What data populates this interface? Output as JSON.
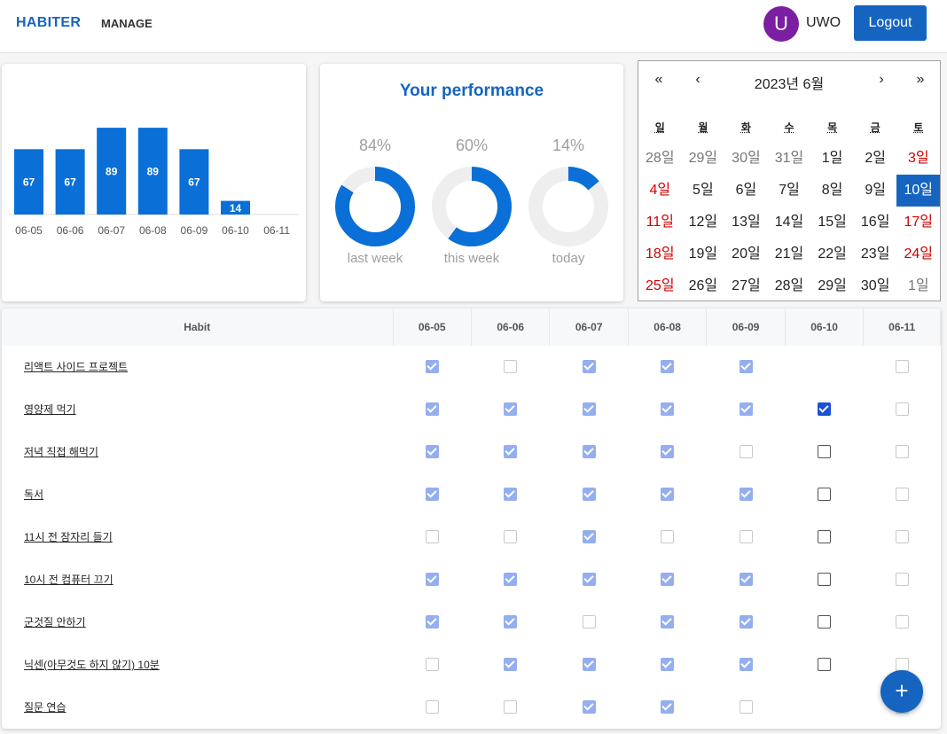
{
  "header": {
    "brand": "HABITER",
    "nav_manage": "MANAGE",
    "avatar_letter": "U",
    "username": "UWO",
    "logout_label": "Logout"
  },
  "chart_data": {
    "type": "bar",
    "categories": [
      "06-05",
      "06-06",
      "06-07",
      "06-08",
      "06-09",
      "06-10",
      "06-11"
    ],
    "values": [
      67,
      67,
      89,
      89,
      67,
      14,
      0
    ],
    "ylim": [
      0,
      100
    ],
    "color": "#0a6fd6"
  },
  "performance": {
    "title": "Your performance",
    "items": [
      {
        "percent_label": "84%",
        "value": 84,
        "label": "last week"
      },
      {
        "percent_label": "60%",
        "value": 60,
        "label": "this week"
      },
      {
        "percent_label": "14%",
        "value": 14,
        "label": "today"
      }
    ],
    "ring_color": "#0a6fd6",
    "track_color": "#eeeeee"
  },
  "calendar": {
    "title": "2023년 6월",
    "nav": {
      "prev_year": "«",
      "prev_month": "‹",
      "next_month": "›",
      "next_year": "»"
    },
    "weekdays": [
      "일",
      "월",
      "화",
      "수",
      "목",
      "금",
      "토"
    ],
    "weeks": [
      [
        {
          "d": "28일",
          "t": "other"
        },
        {
          "d": "29일",
          "t": "other"
        },
        {
          "d": "30일",
          "t": "other"
        },
        {
          "d": "31일",
          "t": "other"
        },
        {
          "d": "1일",
          "t": ""
        },
        {
          "d": "2일",
          "t": ""
        },
        {
          "d": "3일",
          "t": "sun"
        }
      ],
      [
        {
          "d": "4일",
          "t": "sun"
        },
        {
          "d": "5일",
          "t": ""
        },
        {
          "d": "6일",
          "t": ""
        },
        {
          "d": "7일",
          "t": ""
        },
        {
          "d": "8일",
          "t": ""
        },
        {
          "d": "9일",
          "t": ""
        },
        {
          "d": "10일",
          "t": "sel"
        }
      ],
      [
        {
          "d": "11일",
          "t": "sun"
        },
        {
          "d": "12일",
          "t": ""
        },
        {
          "d": "13일",
          "t": ""
        },
        {
          "d": "14일",
          "t": ""
        },
        {
          "d": "15일",
          "t": ""
        },
        {
          "d": "16일",
          "t": ""
        },
        {
          "d": "17일",
          "t": "sun"
        }
      ],
      [
        {
          "d": "18일",
          "t": "sun"
        },
        {
          "d": "19일",
          "t": ""
        },
        {
          "d": "20일",
          "t": ""
        },
        {
          "d": "21일",
          "t": ""
        },
        {
          "d": "22일",
          "t": ""
        },
        {
          "d": "23일",
          "t": ""
        },
        {
          "d": "24일",
          "t": "sun"
        }
      ],
      [
        {
          "d": "25일",
          "t": "sun"
        },
        {
          "d": "26일",
          "t": ""
        },
        {
          "d": "27일",
          "t": ""
        },
        {
          "d": "28일",
          "t": ""
        },
        {
          "d": "29일",
          "t": ""
        },
        {
          "d": "30일",
          "t": ""
        },
        {
          "d": "1일",
          "t": "other"
        }
      ]
    ]
  },
  "habits": {
    "header": "Habit",
    "dates": [
      "06-05",
      "06-06",
      "06-07",
      "06-08",
      "06-09",
      "06-10",
      "06-11"
    ],
    "rows": [
      {
        "name": "리액트 사이드 프로젝트",
        "checks": [
          "c",
          "e",
          "c",
          "c",
          "c",
          "n",
          "e"
        ]
      },
      {
        "name": "영양제 먹기",
        "checks": [
          "c",
          "c",
          "c",
          "c",
          "c",
          "a",
          "e"
        ]
      },
      {
        "name": "저녁 직접 해먹기",
        "checks": [
          "c",
          "c",
          "c",
          "c",
          "e",
          "t",
          "e"
        ]
      },
      {
        "name": "독서",
        "checks": [
          "c",
          "c",
          "c",
          "c",
          "c",
          "t",
          "e"
        ]
      },
      {
        "name": "11시 전 잠자리 들기",
        "checks": [
          "e",
          "e",
          "c",
          "e",
          "e",
          "t",
          "e"
        ]
      },
      {
        "name": "10시 전 컴퓨터 끄기",
        "checks": [
          "c",
          "c",
          "c",
          "c",
          "c",
          "t",
          "e"
        ]
      },
      {
        "name": "군것질 안하기",
        "checks": [
          "c",
          "c",
          "e",
          "c",
          "c",
          "t",
          "e"
        ]
      },
      {
        "name": "닉센(아무것도 하지 않기) 10분",
        "checks": [
          "e",
          "c",
          "c",
          "c",
          "c",
          "t",
          "e"
        ]
      },
      {
        "name": "질문 연습",
        "checks": [
          "e",
          "e",
          "c",
          "c",
          "e",
          "n",
          "e"
        ]
      }
    ]
  },
  "fab": {
    "icon": "plus-icon",
    "label": "+"
  }
}
